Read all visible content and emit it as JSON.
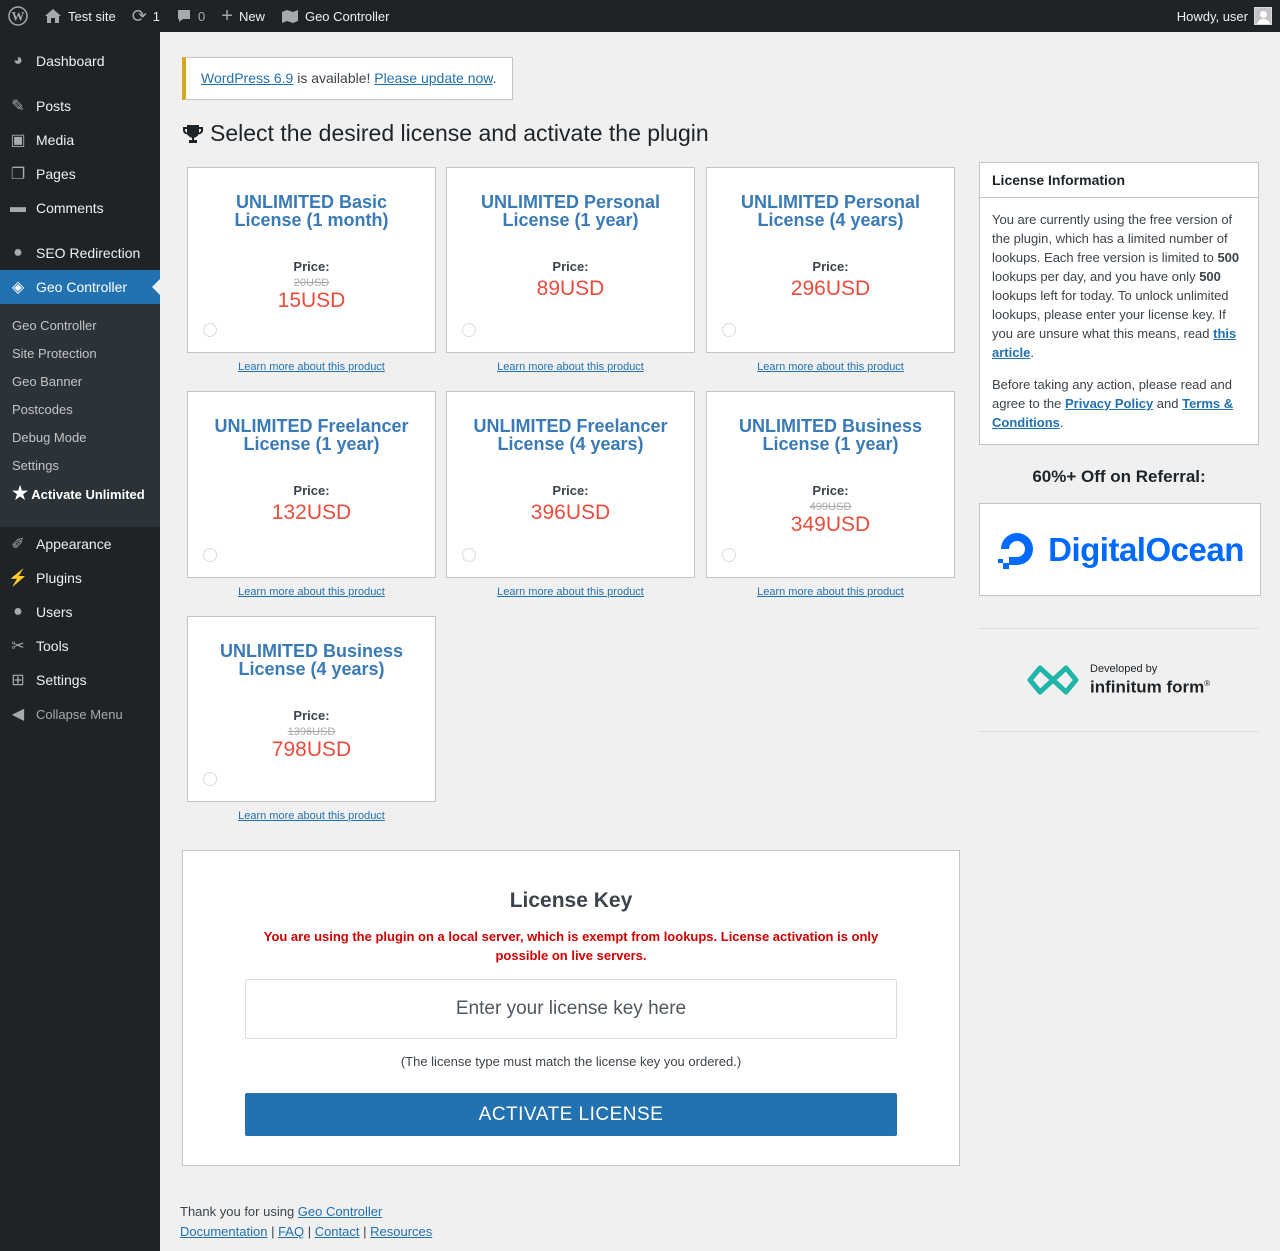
{
  "adminbar": {
    "site_name": "Test site",
    "updates_count": "1",
    "comments_count": "0",
    "new_label": "New",
    "plugin_label": "Geo Controller",
    "howdy": "Howdy, user"
  },
  "sidebar": {
    "items": [
      {
        "label": "Dashboard",
        "icon": "dashboard-icon"
      },
      {
        "label": "Posts",
        "icon": "pin-icon"
      },
      {
        "label": "Media",
        "icon": "media-icon"
      },
      {
        "label": "Pages",
        "icon": "pages-icon"
      },
      {
        "label": "Comments",
        "icon": "comment-icon"
      },
      {
        "label": "SEO Redirection",
        "icon": "location-icon"
      },
      {
        "label": "Geo Controller",
        "icon": "map-icon"
      },
      {
        "label": "Appearance",
        "icon": "brush-icon"
      },
      {
        "label": "Plugins",
        "icon": "plug-icon"
      },
      {
        "label": "Users",
        "icon": "user-icon"
      },
      {
        "label": "Tools",
        "icon": "wrench-icon"
      },
      {
        "label": "Settings",
        "icon": "settings-icon"
      },
      {
        "label": "Collapse Menu",
        "icon": "collapse-icon"
      }
    ],
    "submenu": [
      "Geo Controller",
      "Site Protection",
      "Geo Banner",
      "Postcodes",
      "Debug Mode",
      "Settings",
      "Activate Unlimited"
    ]
  },
  "notice": {
    "link1": "WordPress 6.9",
    "text": " is available! ",
    "link2": "Please update now",
    "end": "."
  },
  "page_title": "Select the desired license and activate the plugin",
  "licenses": [
    {
      "name": "UNLIMITED Basic License (1 month)",
      "price_label": "Price:",
      "old_price": "20USD",
      "price": "15USD"
    },
    {
      "name": "UNLIMITED Personal License (1 year)",
      "price_label": "Price:",
      "old_price": "",
      "price": "89USD"
    },
    {
      "name": "UNLIMITED Personal License (4 years)",
      "price_label": "Price:",
      "old_price": "",
      "price": "296USD"
    },
    {
      "name": "UNLIMITED Freelancer License (1 year)",
      "price_label": "Price:",
      "old_price": "",
      "price": "132USD"
    },
    {
      "name": "UNLIMITED Freelancer License (4 years)",
      "price_label": "Price:",
      "old_price": "",
      "price": "396USD"
    },
    {
      "name": "UNLIMITED Business License (1 year)",
      "price_label": "Price:",
      "old_price": "499USD",
      "price": "349USD"
    },
    {
      "name": "UNLIMITED Business License (4 years)",
      "price_label": "Price:",
      "old_price": "1396USD",
      "price": "798USD"
    }
  ],
  "learn_more": "Learn more about this product",
  "license_key": {
    "title": "License Key",
    "warning": "You are using the plugin on a local server, which is exempt from lookups. License activation is only possible on live servers.",
    "placeholder": "Enter your license key here",
    "hint": "(The license type must match the license key you ordered.)",
    "button": "ACTIVATE LICENSE"
  },
  "license_info": {
    "title": "License Information",
    "p1_a": "You are currently using the free version of the plugin, which has a limited number of lookups. Each free version is limited to ",
    "p1_limit": "500",
    "p1_b": " lookups per day, and you have only ",
    "p1_left": "500",
    "p1_c": " lookups left for today. To unlock unlimited lookups, please enter your license key. If you are unsure what this means, read ",
    "p1_link": "this article",
    "p1_end": ".",
    "p2_a": "Before taking any action, please read and agree to the ",
    "p2_link1": "Privacy Policy",
    "p2_and": " and ",
    "p2_link2": "Terms & Conditions",
    "p2_end": "."
  },
  "referral": {
    "title": "60%+ Off on Referral:",
    "brand": "DigitalOcean"
  },
  "developer": {
    "by": "Developed by",
    "brand": "infinitum form",
    "mark": "®"
  },
  "footer": {
    "thanks": "Thank you for using ",
    "plugin_link": "Geo Controller",
    "links": [
      "Documentation",
      "FAQ",
      "Contact",
      "Resources"
    ],
    "separator": " | "
  },
  "colors": {
    "accent": "#2271b1",
    "price": "#e74c3c",
    "license_name": "#3a7ab5",
    "warning": "#d00000",
    "digitalocean": "#0069ff",
    "infinitum": "#1fb5a8"
  }
}
